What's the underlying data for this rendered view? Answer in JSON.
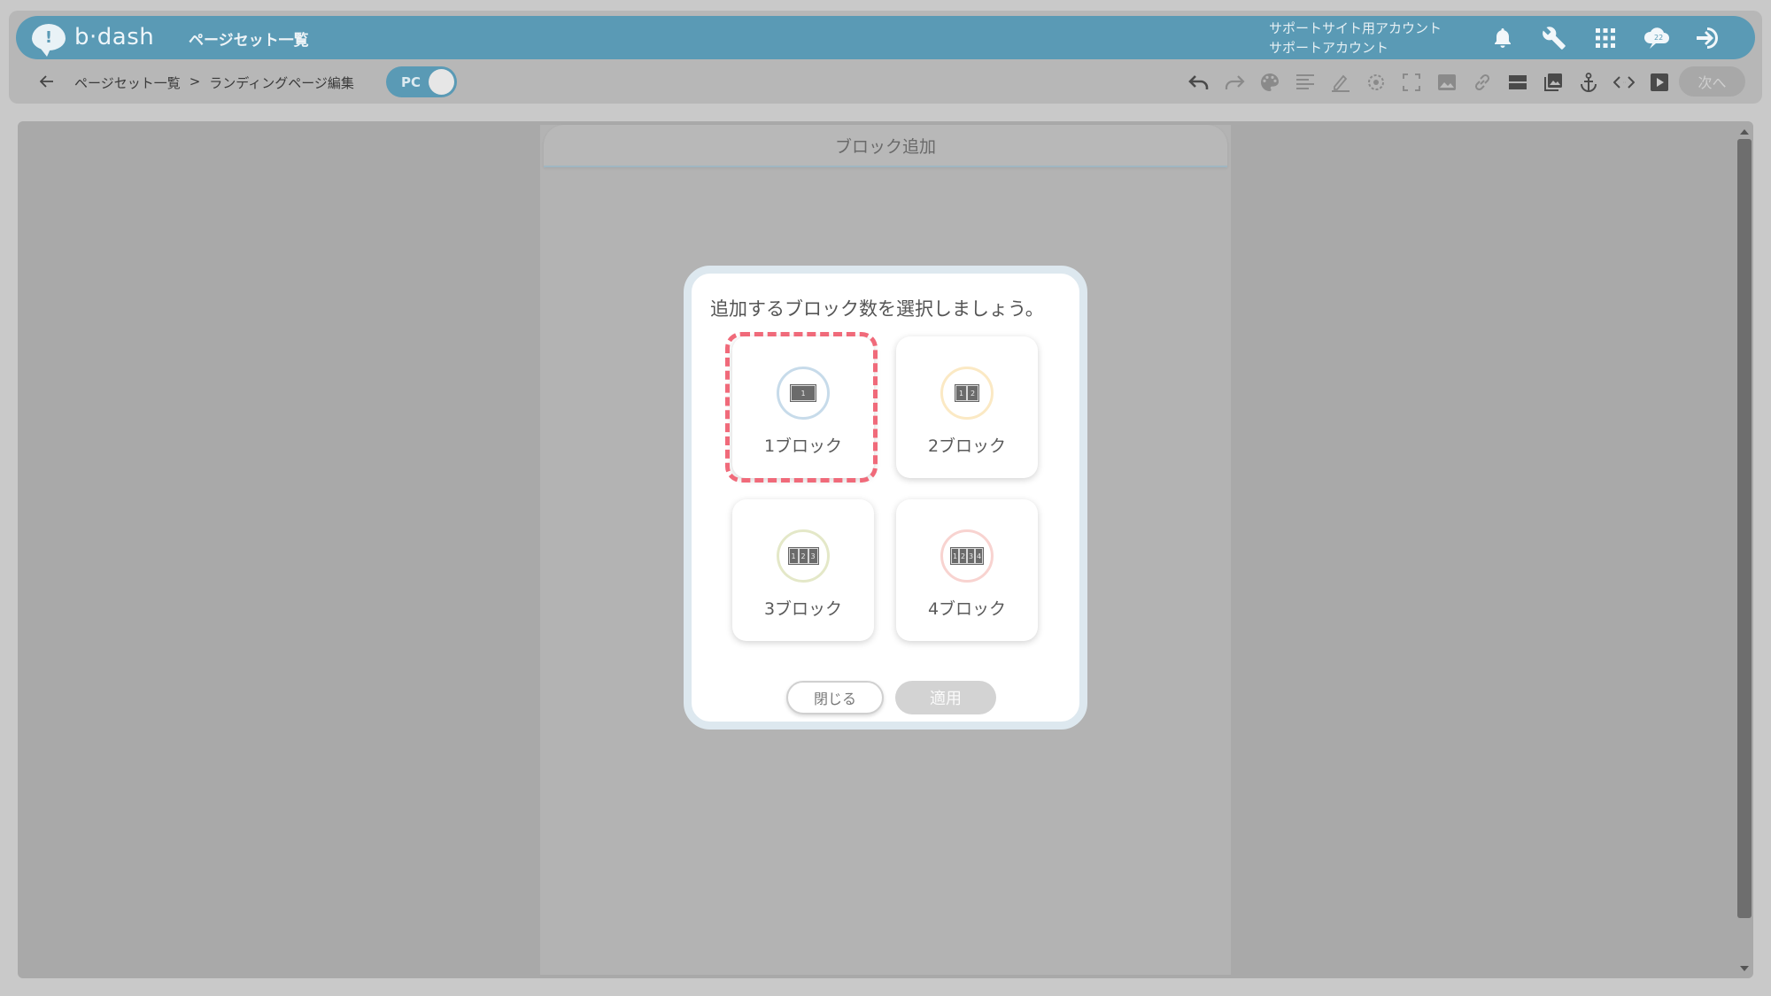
{
  "app": {
    "logo_text": "b·dash",
    "logo_mark": "!",
    "title": "ページセット一覧",
    "account_line1": "サポートサイト用アカウント",
    "account_line2": "サポートアカウント",
    "icons": [
      "bell-icon",
      "wrench-icon",
      "grid-apps-icon",
      "cloud-chat-icon",
      "logout-icon"
    ]
  },
  "subbar": {
    "breadcrumb": [
      "ページセット一覧",
      ">",
      "ランディングページ編集"
    ],
    "device_toggle": "PC",
    "next_label": "次へ",
    "tools": [
      "undo-icon",
      "redo-icon",
      "palette-icon",
      "align-text-icon",
      "pen-icon",
      "target-icon",
      "fullscreen-icon",
      "image-icon",
      "link-icon",
      "layout-block-icon",
      "gallery-icon",
      "anchor-icon",
      "code-icon",
      "play-icon"
    ]
  },
  "page": {
    "header_label": "ブロック追加"
  },
  "modal": {
    "title": "追加するブロック数を選択しましょう。",
    "options": [
      {
        "label": "1ブロック",
        "ring_color": "#c7dbea",
        "cells": [
          "1"
        ]
      },
      {
        "label": "2ブロック",
        "ring_color": "#fbe9c4",
        "cells": [
          "1",
          "2"
        ]
      },
      {
        "label": "3ブロック",
        "ring_color": "#e4e8c8",
        "cells": [
          "1",
          "2",
          "3"
        ]
      },
      {
        "label": "4ブロック",
        "ring_color": "#f8d3d0",
        "cells": [
          "1",
          "2",
          "3",
          "4"
        ]
      }
    ],
    "close_label": "閉じる",
    "apply_label": "適用",
    "highlight_color": "#f06a7a"
  }
}
